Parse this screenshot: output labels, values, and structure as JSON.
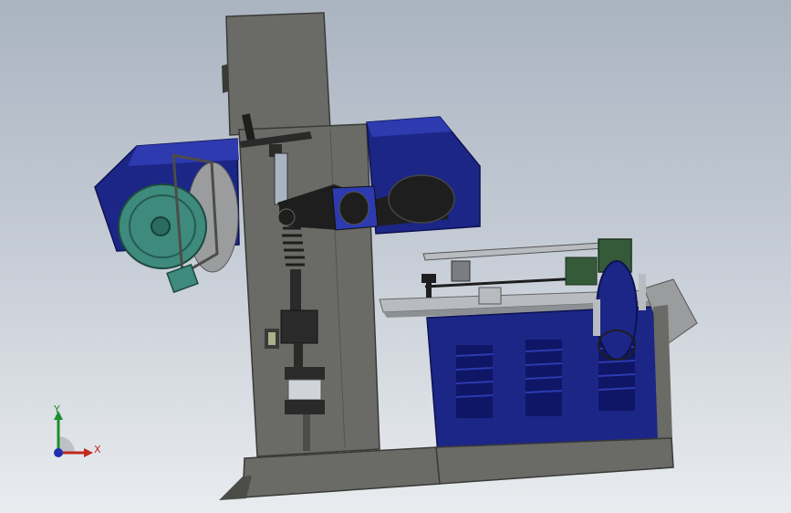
{
  "viewport": {
    "background_top": "#aab4c1",
    "background_bottom": "#e9ecef"
  },
  "model": {
    "parts": [
      "main-column",
      "left-wheel-housing",
      "pulley-wheel",
      "right-blade-guard",
      "lever-arm",
      "handwheel",
      "lead-screw",
      "pneumatic-cylinder",
      "feed-table",
      "cabinet",
      "motor",
      "base-plate"
    ],
    "colors": {
      "frame": "#6a6a66",
      "frame_dark": "#4c4c48",
      "housing_blue": "#1c2686",
      "housing_blue_light": "#2d3ab0",
      "pulley_teal": "#3e8a7c",
      "motor_green": "#355a3a",
      "black_part": "#1e1e1e",
      "steel": "#b8bcc0"
    }
  },
  "triad": {
    "y_label": "Y",
    "x_label": "X",
    "y_color": "#1b8d2a",
    "x_color": "#c0291f",
    "z_color": "#2030b0"
  }
}
